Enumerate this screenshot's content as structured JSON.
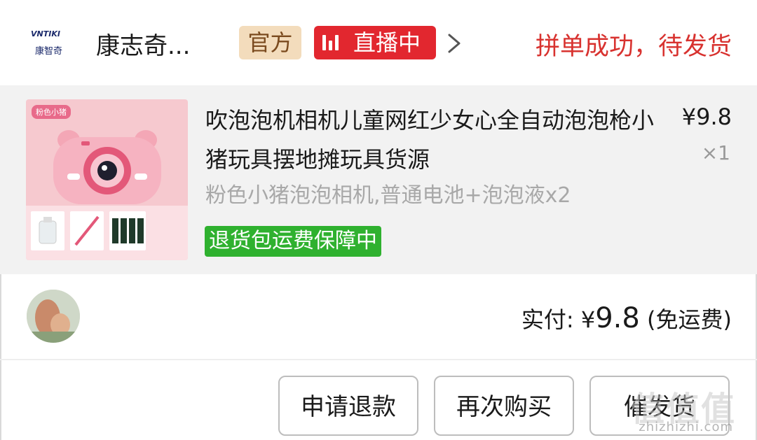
{
  "header": {
    "logo_text": "VNTIKI",
    "logo_cn": "康智奇",
    "shop_name": "康志奇...",
    "official_tag": "官方",
    "live_tag": "直播中",
    "order_status": "拼单成功，待发货"
  },
  "product": {
    "thumb_badge": "粉色小猪",
    "title": "吹泡泡机相机儿童网红少女心全自动泡泡枪小猪玩具摆地摊玩具货源",
    "price": "¥9.8",
    "quantity": "×1",
    "spec": "粉色小猪泡泡相机,普通电池+泡泡液x2",
    "guarantee": "退货包运费保障中"
  },
  "payment": {
    "label": "实付: ¥",
    "amount": "9.8",
    "shipping_note": " (免运费)"
  },
  "actions": {
    "refund": "申请退款",
    "rebuy": "再次购买",
    "urge_ship": "催发货"
  },
  "watermark": {
    "text": "值值值",
    "url": "zhizhizhi.com"
  },
  "colors": {
    "status_red": "#d8322f",
    "live_red": "#e2272f",
    "guarantee_green": "#2fb12f",
    "official_bg": "#f3dcbc",
    "product_bg": "#f2f2f2"
  }
}
